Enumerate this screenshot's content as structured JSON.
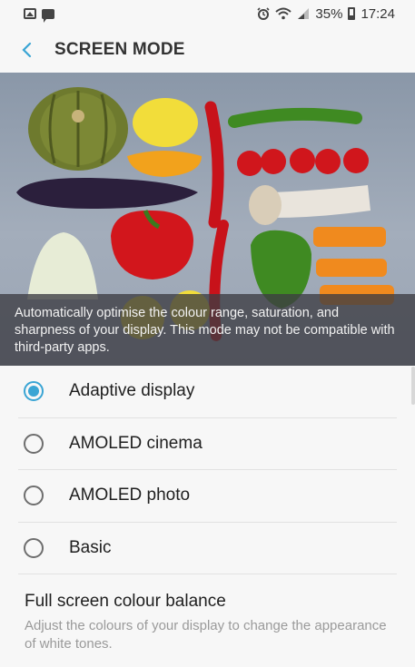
{
  "status_bar": {
    "left_icons": [
      "gallery-icon",
      "message-icon"
    ],
    "right_icons": [
      "alarm-icon",
      "wifi-icon",
      "signal-icon",
      "battery-icon"
    ],
    "battery": "35%",
    "time": "17:24"
  },
  "header": {
    "title": "SCREEN MODE",
    "back_icon": "back-arrow-icon",
    "accent_color": "#3aa5d4"
  },
  "hero": {
    "caption": "Automatically optimise the colour range, saturation, and sharpness of your display. This mode may not be compatible with third-party apps."
  },
  "options": [
    {
      "label": "Adaptive display",
      "selected": true
    },
    {
      "label": "AMOLED cinema",
      "selected": false
    },
    {
      "label": "AMOLED photo",
      "selected": false
    },
    {
      "label": "Basic",
      "selected": false
    }
  ],
  "balance": {
    "title": "Full screen colour balance",
    "description": "Adjust the colours of your display to change the appearance of white tones."
  }
}
